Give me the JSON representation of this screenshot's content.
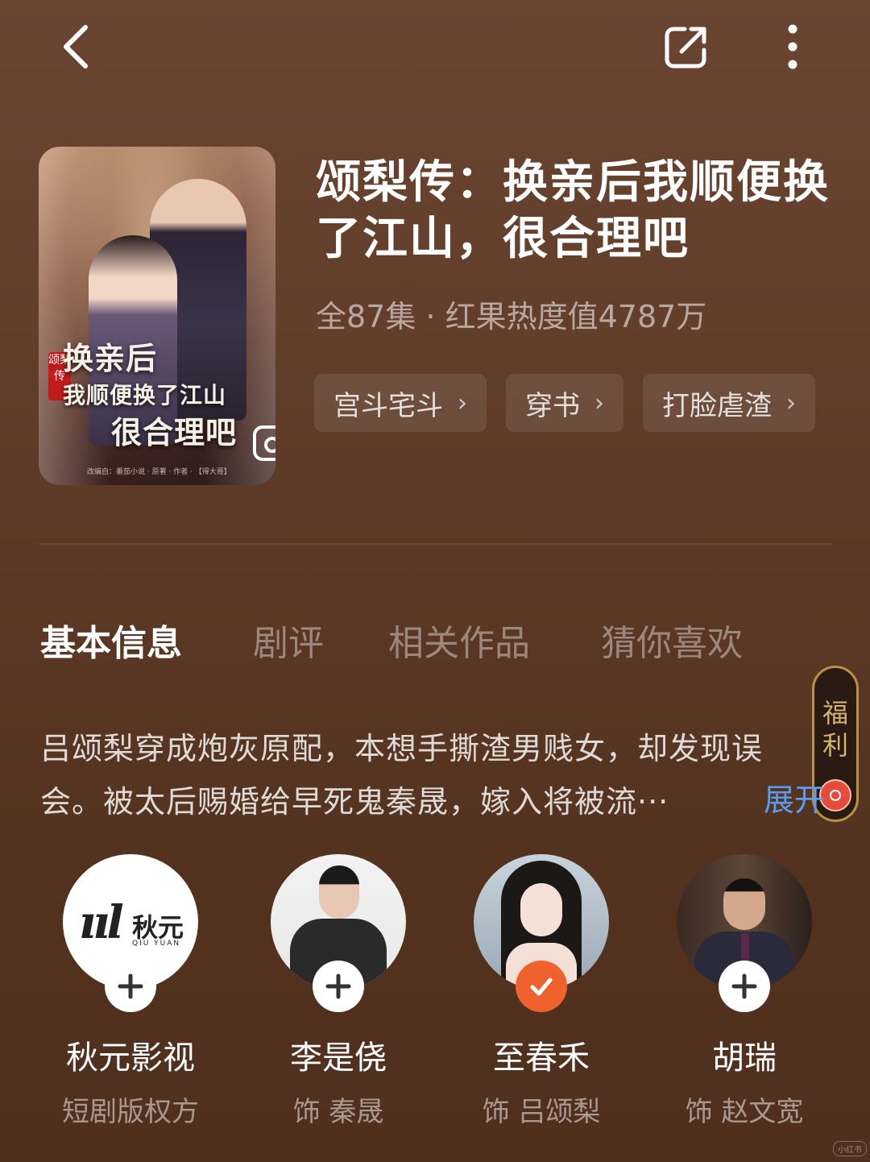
{
  "drama": {
    "title": "颂梨传：换亲后我顺便换了江山，很合理吧",
    "meta": "全87集 · 红果热度值4787万",
    "tags": [
      "宫斗宅斗",
      "穿书",
      "打脸虐渣"
    ],
    "poster": {
      "title_lines": [
        "换亲后",
        "我顺便换了江山",
        "很合理吧"
      ],
      "seal": "颂梨传",
      "credit": "改编自：番茄小说 · 原著 · 作者 · 【得大哥】"
    }
  },
  "tabs": [
    {
      "label": "基本信息",
      "active": true
    },
    {
      "label": "剧评",
      "active": false
    },
    {
      "label": "相关作品",
      "active": false
    },
    {
      "label": "猜你喜欢",
      "active": false
    }
  ],
  "synopsis": {
    "line1": "吕颂梨穿成炮灰原配，本想手撕渣男贱女，却发现误",
    "line2": "会。被太后赐婚给早死鬼秦晟，嫁入将被流···",
    "expand_label": "展开"
  },
  "fuli": {
    "label": "福利"
  },
  "cast": [
    {
      "name": "秋元影视",
      "role": "短剧版权方",
      "followed": false,
      "logo_text": "QIU YUAN",
      "logo_zh": "秋元"
    },
    {
      "name": "李是侥",
      "role": "饰 秦晟",
      "followed": false
    },
    {
      "name": "至春禾",
      "role": "饰 吕颂梨",
      "followed": true
    },
    {
      "name": "胡瑞",
      "role": "饰 赵文宽",
      "followed": false
    }
  ],
  "watermark": "小红书",
  "colors": {
    "follow_accent": "#f0622d",
    "expand_link": "#5a9cf0",
    "fuli_gold": "#b8923e"
  }
}
